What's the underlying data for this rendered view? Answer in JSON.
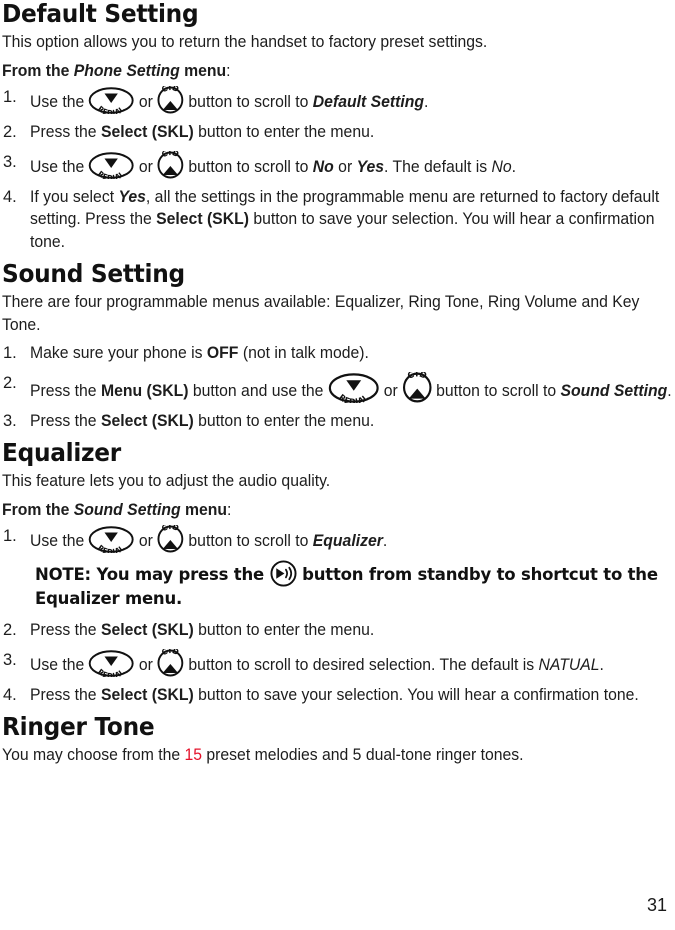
{
  "document": {
    "page_number": "31",
    "accent_red": "#e4112a"
  },
  "icons": {
    "redial": {
      "name": "redial-button-icon",
      "label": "REDIAL",
      "direction": "down"
    },
    "cid": {
      "name": "cid-button-icon",
      "label": "CID",
      "direction": "up"
    },
    "speaker": {
      "name": "speaker-button-icon",
      "label": "speaker"
    }
  },
  "sections": [
    {
      "id": "default-setting",
      "heading": "Default Setting",
      "intro": "This option allows you to return the handset to factory preset settings.",
      "from_line": {
        "lead": "From the ",
        "menu_name": "Phone Setting",
        "tail": " menu",
        "colon": ":"
      },
      "steps": [
        {
          "num": "1.",
          "parts": [
            {
              "t": "text",
              "v": "Use the "
            },
            {
              "t": "icon",
              "v": "redial"
            },
            {
              "t": "text",
              "v": " or "
            },
            {
              "t": "icon",
              "v": "cid"
            },
            {
              "t": "text",
              "v": " button to scroll to "
            },
            {
              "t": "bolditalic",
              "v": "Default Setting"
            },
            {
              "t": "text",
              "v": "."
            }
          ]
        },
        {
          "num": "2.",
          "parts": [
            {
              "t": "text",
              "v": "Press the "
            },
            {
              "t": "bold",
              "v": "Select (SKL)"
            },
            {
              "t": "text",
              "v": " button to enter the menu."
            }
          ]
        },
        {
          "num": "3.",
          "parts": [
            {
              "t": "text",
              "v": "Use the "
            },
            {
              "t": "icon",
              "v": "redial"
            },
            {
              "t": "text",
              "v": " or "
            },
            {
              "t": "icon",
              "v": "cid"
            },
            {
              "t": "text",
              "v": " button to scroll to "
            },
            {
              "t": "bolditalic",
              "v": "No"
            },
            {
              "t": "text",
              "v": " or "
            },
            {
              "t": "bolditalic",
              "v": "Yes"
            },
            {
              "t": "text",
              "v": ". The default is "
            },
            {
              "t": "italic",
              "v": "No"
            },
            {
              "t": "text",
              "v": "."
            }
          ]
        },
        {
          "num": "4.",
          "parts": [
            {
              "t": "text",
              "v": "If you select "
            },
            {
              "t": "bolditalic",
              "v": "Yes"
            },
            {
              "t": "text",
              "v": ", all the settings in the programmable menu are returned to factory default setting. Press the "
            },
            {
              "t": "bold",
              "v": "Select (SKL)"
            },
            {
              "t": "text",
              "v": " button to save your selection. You will hear a confirmation tone."
            }
          ]
        }
      ]
    },
    {
      "id": "sound-setting",
      "heading": "Sound Setting",
      "intro": "There are four programmable menus available: Equalizer, Ring Tone, Ring Volume and Key Tone.",
      "steps": [
        {
          "num": "1.",
          "parts": [
            {
              "t": "text",
              "v": "Make sure your phone is "
            },
            {
              "t": "bold",
              "v": "OFF"
            },
            {
              "t": "text",
              "v": " (not in talk mode)."
            }
          ]
        },
        {
          "num": "2.",
          "parts": [
            {
              "t": "text",
              "v": "Press the "
            },
            {
              "t": "bold",
              "v": "Menu (SKL)"
            },
            {
              "t": "text",
              "v": " button and use the "
            },
            {
              "t": "icon-big",
              "v": "redial"
            },
            {
              "t": "text",
              "v": " or "
            },
            {
              "t": "icon-big",
              "v": "cid"
            },
            {
              "t": "text",
              "v": " button to scroll to "
            },
            {
              "t": "bolditalic",
              "v": "Sound Setting"
            },
            {
              "t": "text",
              "v": "."
            }
          ]
        },
        {
          "num": "3.",
          "parts": [
            {
              "t": "text",
              "v": "Press the "
            },
            {
              "t": "bold",
              "v": "Select (SKL)"
            },
            {
              "t": "text",
              "v": " button to enter the menu."
            }
          ]
        }
      ]
    },
    {
      "id": "equalizer",
      "heading": "Equalizer",
      "intro": "This feature lets you to adjust the audio quality.",
      "from_line": {
        "lead": "From the ",
        "menu_name": "Sound Setting",
        "tail": " menu",
        "colon": ":"
      },
      "steps": [
        {
          "num": "1.",
          "parts": [
            {
              "t": "text",
              "v": "Use the "
            },
            {
              "t": "icon",
              "v": "redial"
            },
            {
              "t": "text",
              "v": " or "
            },
            {
              "t": "icon",
              "v": "cid"
            },
            {
              "t": "text",
              "v": " button to scroll to "
            },
            {
              "t": "bolditalic",
              "v": "Equalizer"
            },
            {
              "t": "text",
              "v": "."
            }
          ],
          "note": {
            "lead": "NOTE: You may press the ",
            "icon": "speaker",
            "tail": " button from standby to shortcut to the Equalizer menu."
          }
        },
        {
          "num": "2.",
          "parts": [
            {
              "t": "text",
              "v": "Press the "
            },
            {
              "t": "bold",
              "v": "Select (SKL)"
            },
            {
              "t": "text",
              "v": " button to enter the menu."
            }
          ]
        },
        {
          "num": "3.",
          "parts": [
            {
              "t": "text",
              "v": "Use the "
            },
            {
              "t": "icon",
              "v": "redial"
            },
            {
              "t": "text",
              "v": " or "
            },
            {
              "t": "icon",
              "v": "cid"
            },
            {
              "t": "text",
              "v": " button to scroll to desired selection. The default is "
            },
            {
              "t": "italic",
              "v": "NATUAL"
            },
            {
              "t": "text",
              "v": "."
            }
          ]
        },
        {
          "num": "4.",
          "parts": [
            {
              "t": "text",
              "v": "Press the "
            },
            {
              "t": "bold",
              "v": "Select (SKL)"
            },
            {
              "t": "text",
              "v": " button to save your selection. You will hear a confirmation tone."
            }
          ]
        }
      ]
    },
    {
      "id": "ringer-tone",
      "heading": "Ringer Tone",
      "intro_parts": [
        {
          "t": "text",
          "v": "You may choose from the "
        },
        {
          "t": "red",
          "v": "15"
        },
        {
          "t": "text",
          "v": " preset melodies and 5 dual-tone ringer tones."
        }
      ]
    }
  ]
}
